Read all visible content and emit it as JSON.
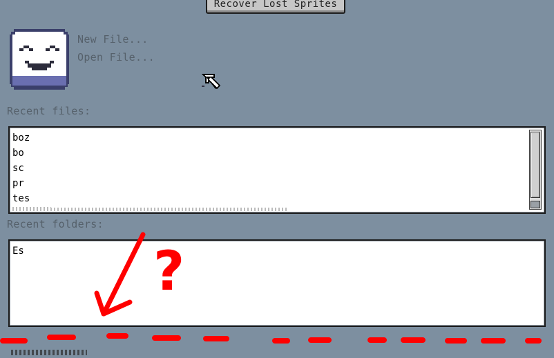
{
  "top_button": {
    "label": "Recover Lost Sprites"
  },
  "start_menu": {
    "new_file": "New File...",
    "open_file": "Open File..."
  },
  "recent_files": {
    "label": "Recent files:",
    "items": [
      "boz",
      "bo",
      "sc",
      "pr",
      "tes"
    ]
  },
  "recent_folders": {
    "label": "Recent folders:",
    "items": [
      "Es"
    ]
  },
  "annotation": {
    "mark": "?",
    "color": "#ff0000"
  },
  "colors": {
    "background": "#7d8fa0",
    "link_text": "#56616b",
    "list_bg": "#ffffff",
    "annotation_red": "#ff0000"
  },
  "icons": [
    "smiley-logo-icon",
    "arrow-cursor-icon"
  ]
}
